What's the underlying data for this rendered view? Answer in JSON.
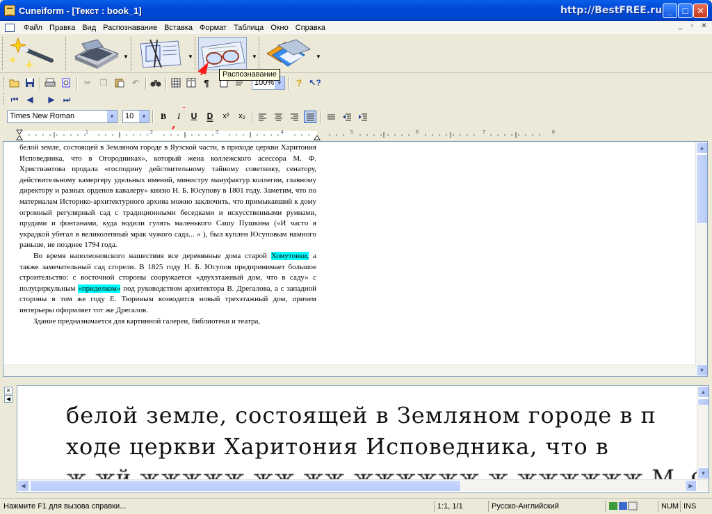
{
  "window": {
    "title": "Cuneiform - [Текст : book_1]",
    "watermark": "http://BestFREE.ru",
    "controls": [
      "_",
      "□",
      "✕"
    ]
  },
  "menu": {
    "items": [
      "Файл",
      "Правка",
      "Вид",
      "Распознавание",
      "Вставка",
      "Формат",
      "Таблица",
      "Окно",
      "Справка"
    ],
    "mdi_controls": [
      "_",
      "▫",
      "✕"
    ]
  },
  "big_toolbar": {
    "buttons": [
      "magic-wand",
      "scanner",
      "layout",
      "recognize-glasses",
      "save-export"
    ],
    "tooltip": "Распознавание"
  },
  "format_toolbar": {
    "font": "Times New Roman",
    "size": "10",
    "zoom": "100%",
    "bold": "B",
    "italic": "I",
    "underline": "U",
    "double_underline": "D",
    "superscript": "x²",
    "subscript": "x₂"
  },
  "ruler": {
    "ticks": [
      "1",
      "2",
      "3",
      "4",
      "5",
      "6",
      "7",
      "8"
    ]
  },
  "document": {
    "p1": "белой земле, состоящей в Земляном городе в Яузской части, в приходе церкви Харитония Исповедника, что в Огородниках», который жена коллежского асессора М. Ф. Христиантова продала «господину действительному тайному советнику, сенатору, действительному камергеру удельных имений, министру мануфактур коллегии, главному директору и разных орденов кавалеру» князю Н. Б. Юсупову в 1801 году. Заметим, что по материалам Историко-архитектурного архива можно заключить, что примыкавший к дому огромный регулярный сад с традиционными беседками и искусственными руинами, прудами и фонтанами, куда водили гулять маленького Сашу Пушкина («И часто я украдкой убегал в великолепный мрак чужого сада... » ), был куплен Юсуповым намного раньше, не позднее 1794 года.",
    "p2_a": "Во время наполеоновского нашествия все деревянные дома старой ",
    "p2_hl1": "Хомутовки,",
    "p2_b": " а также замечательный сад сгорели. В 1825 году Н. Б. Юсупов предпринимает большое строительство: с восточной стороны сооружается «двухэтажный дом, что в саду» с полуциркульным ",
    "p2_hl2": "«приделком»",
    "p2_c": " под руководством архитектора В. Дрегалова, а с западной стороны в том же году Е. Тюриным возводится новый трехэтажный дом, причем интерьеры оформляет тот же Дрегалов.",
    "p3": "Здание предназначается для картинной галереи, библиотеки и театра,"
  },
  "scan": {
    "line1": "белой земле, состоящей в Земляном городе в п",
    "line2": "ходе церкви Харитония Исповедника, что в",
    "line3": "ж жй жжжжж жж жж жжжжжж ж жжжжжж М. Ф. Х"
  },
  "status": {
    "help": "Нажмите F1 для вызова справки...",
    "position": "1:1,  1/1",
    "language": "Русско-Английский",
    "num": "NUM",
    "ins": "INS"
  }
}
